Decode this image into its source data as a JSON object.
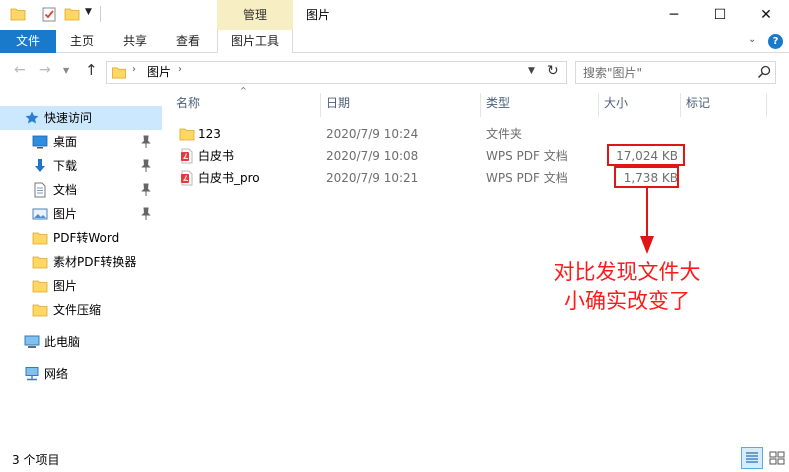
{
  "window": {
    "title": "图片",
    "context_tab": "管理",
    "min_symbol": "─",
    "max_symbol": "☐",
    "close_symbol": "✕"
  },
  "ribbon": {
    "tabs": [
      "文件",
      "主页",
      "共享",
      "查看",
      "图片工具"
    ],
    "expand_symbol": "⌄",
    "help_symbol": "?"
  },
  "address": {
    "crumb": "图片",
    "sep": "›"
  },
  "search": {
    "placeholder": "搜索\"图片\""
  },
  "sidebar": {
    "items": [
      {
        "label": "快速访问",
        "icon": "star-icon",
        "pinned": false,
        "selected": true
      },
      {
        "label": "桌面",
        "icon": "desktop-icon",
        "pinned": true
      },
      {
        "label": "下载",
        "icon": "download-icon",
        "pinned": true
      },
      {
        "label": "文档",
        "icon": "document-icon",
        "pinned": true
      },
      {
        "label": "图片",
        "icon": "pictures-icon",
        "pinned": true
      },
      {
        "label": "PDF转Word",
        "icon": "folder-icon",
        "pinned": false
      },
      {
        "label": "素材PDF转换器",
        "icon": "folder-icon",
        "pinned": false
      },
      {
        "label": "图片",
        "icon": "folder-icon",
        "pinned": false
      },
      {
        "label": "文件压缩",
        "icon": "folder-icon",
        "pinned": false
      },
      {
        "label": "此电脑",
        "icon": "computer-icon",
        "pinned": false
      },
      {
        "label": "网络",
        "icon": "network-icon",
        "pinned": false
      }
    ]
  },
  "columns": [
    "名称",
    "日期",
    "类型",
    "大小",
    "标记"
  ],
  "files": [
    {
      "name": "123",
      "date": "2020/7/9 10:24",
      "type": "文件夹",
      "size": "",
      "icon": "folder-icon"
    },
    {
      "name": "白皮书",
      "date": "2020/7/9 10:08",
      "type": "WPS PDF 文档",
      "size": "17,024 KB",
      "icon": "pdf-icon"
    },
    {
      "name": "白皮书_pro",
      "date": "2020/7/9 10:21",
      "type": "WPS PDF 文档",
      "size": "1,738 KB",
      "icon": "pdf-icon"
    }
  ],
  "annotation": {
    "line1": "对比发现文件大",
    "line2": "小确实改变了",
    "color": "#ff1a1a"
  },
  "status": {
    "count": "3 个项目"
  },
  "colors": {
    "accent": "#1979ca",
    "context_tab": "#f7eec4",
    "selected": "#cce8ff",
    "folder": "#ffd762"
  }
}
